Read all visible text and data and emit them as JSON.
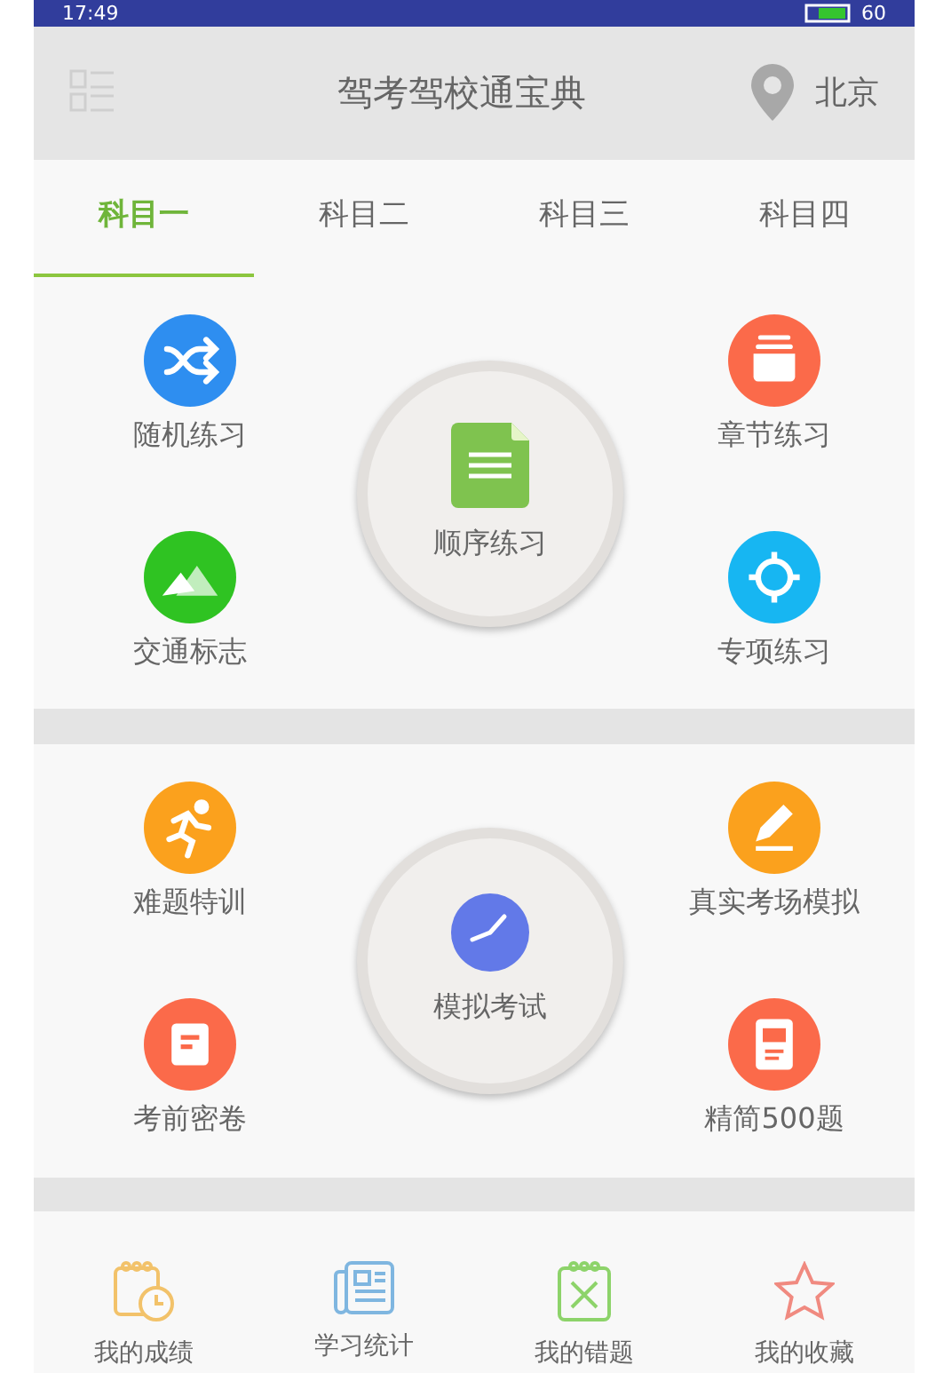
{
  "status_bar": {
    "time": "17:49",
    "battery": "60"
  },
  "header": {
    "title": "驾考驾校通宝典",
    "city": "北京"
  },
  "tabs": [
    {
      "label": "科目一",
      "selected": true
    },
    {
      "label": "科目二",
      "selected": false
    },
    {
      "label": "科目三",
      "selected": false
    },
    {
      "label": "科目四",
      "selected": false
    }
  ],
  "sections": [
    {
      "left": [
        {
          "label": "随机练习",
          "kind": "shuffle",
          "color": "#2e8ef0"
        },
        {
          "label": "交通标志",
          "kind": "mountain",
          "color": "#2fc322"
        }
      ],
      "center": {
        "label": "顺序练习",
        "kind": "document"
      },
      "right": [
        {
          "label": "章节练习",
          "kind": "box",
          "color": "#fb6a4a"
        },
        {
          "label": "专项练习",
          "kind": "target",
          "color": "#17b6f2"
        }
      ]
    },
    {
      "left": [
        {
          "label": "难题特训",
          "kind": "runner",
          "color": "#fba11d"
        },
        {
          "label": "考前密卷",
          "kind": "note",
          "color": "#fb6a4a"
        }
      ],
      "center": {
        "label": "模拟考试",
        "kind": "clock"
      },
      "right": [
        {
          "label": "真实考场模拟",
          "kind": "pencil",
          "color": "#fba11d"
        },
        {
          "label": "精简500题",
          "kind": "paper",
          "color": "#fb6a4a"
        }
      ]
    }
  ],
  "bottom_nav": [
    {
      "label": "我的成绩",
      "kind": "calendar"
    },
    {
      "label": "学习统计",
      "kind": "news"
    },
    {
      "label": "我的错题",
      "kind": "cross"
    },
    {
      "label": "我的收藏",
      "kind": "star"
    }
  ]
}
